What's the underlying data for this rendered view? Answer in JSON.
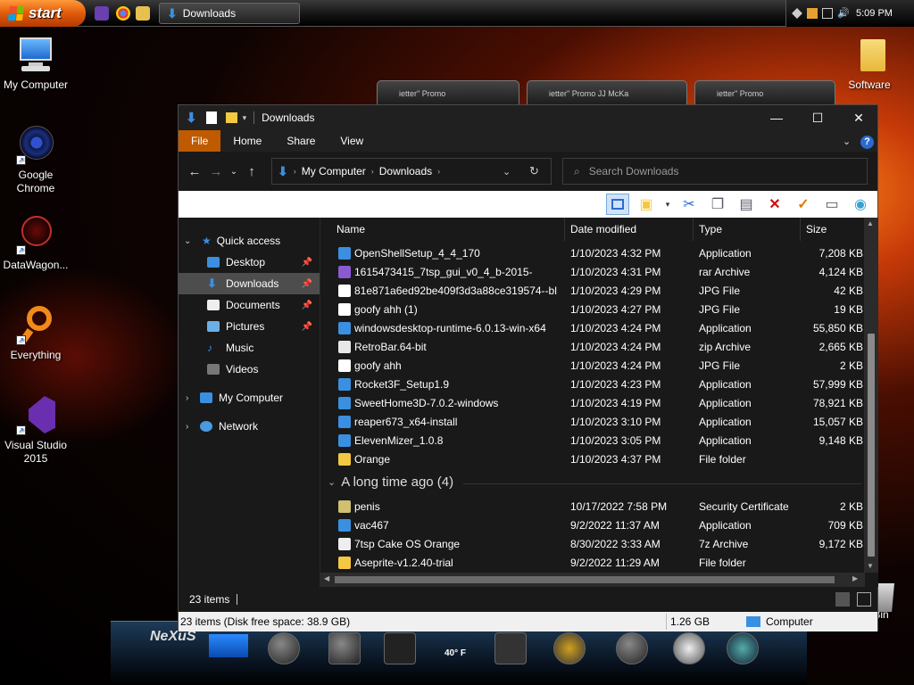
{
  "taskbar": {
    "start_label": "start",
    "task_label": "Downloads",
    "clock": "5:09 PM"
  },
  "desktop_icons": {
    "my_computer": "My Computer",
    "chrome": "Google Chrome",
    "datawagon": "DataWagon...",
    "everything": "Everything",
    "vs": "Visual Studio 2015",
    "software": "Software",
    "recycle": "e Bin"
  },
  "widgets": [
    "ietter\" Promo",
    "ietter\" Promo JJ McKa",
    "ietter\" Promo"
  ],
  "dock": {
    "weather": "40° F"
  },
  "window": {
    "title": "Downloads",
    "ribbon_tabs": [
      "File",
      "Home",
      "Share",
      "View"
    ],
    "address": {
      "seg1": "My Computer",
      "seg2": "Downloads"
    },
    "search_placeholder": "Search Downloads",
    "nav": {
      "quick_access": "Quick access",
      "desktop": "Desktop",
      "downloads": "Downloads",
      "documents": "Documents",
      "pictures": "Pictures",
      "music": "Music",
      "videos": "Videos",
      "my_computer": "My Computer",
      "network": "Network"
    },
    "columns": {
      "name": "Name",
      "date": "Date modified",
      "type": "Type",
      "size": "Size"
    },
    "files": [
      {
        "name": "OpenShellSetup_4_4_170",
        "date": "1/10/2023 4:32 PM",
        "type": "Application",
        "size": "7,208 KB"
      },
      {
        "name": "1615473415_7tsp_gui_v0_4_b-2015-",
        "date": "1/10/2023 4:31 PM",
        "type": "rar Archive",
        "size": "4,124 KB"
      },
      {
        "name": "81e871a6ed92be409f3d3a88ce319574--bl...",
        "date": "1/10/2023 4:29 PM",
        "type": "JPG File",
        "size": "42 KB"
      },
      {
        "name": "goofy ahh (1)",
        "date": "1/10/2023 4:27 PM",
        "type": "JPG File",
        "size": "19 KB"
      },
      {
        "name": "windowsdesktop-runtime-6.0.13-win-x64",
        "date": "1/10/2023 4:24 PM",
        "type": "Application",
        "size": "55,850 KB"
      },
      {
        "name": "RetroBar.64-bit",
        "date": "1/10/2023 4:24 PM",
        "type": "zip Archive",
        "size": "2,665 KB"
      },
      {
        "name": "goofy ahh",
        "date": "1/10/2023 4:24 PM",
        "type": "JPG File",
        "size": "2 KB"
      },
      {
        "name": "Rocket3F_Setup1.9",
        "date": "1/10/2023 4:23 PM",
        "type": "Application",
        "size": "57,999 KB"
      },
      {
        "name": "SweetHome3D-7.0.2-windows",
        "date": "1/10/2023 4:19 PM",
        "type": "Application",
        "size": "78,921 KB"
      },
      {
        "name": "reaper673_x64-install",
        "date": "1/10/2023 3:10 PM",
        "type": "Application",
        "size": "15,057 KB"
      },
      {
        "name": "ElevenMizer_1.0.8",
        "date": "1/10/2023 3:05 PM",
        "type": "Application",
        "size": "9,148 KB"
      },
      {
        "name": "Orange",
        "date": "1/10/2023 4:37 PM",
        "type": "File folder",
        "size": ""
      }
    ],
    "group_label": "A long time ago (4)",
    "old_files": [
      {
        "name": "penis",
        "date": "10/17/2022 7:58 PM",
        "type": "Security Certificate",
        "size": "2 KB"
      },
      {
        "name": "vac467",
        "date": "9/2/2022 11:37 AM",
        "type": "Application",
        "size": "709 KB"
      },
      {
        "name": "7tsp Cake OS Orange",
        "date": "8/30/2022 3:33 AM",
        "type": "7z Archive",
        "size": "9,172 KB"
      },
      {
        "name": "Aseprite-v1.2.40-trial",
        "date": "9/2/2022 11:29 AM",
        "type": "File folder",
        "size": ""
      }
    ],
    "status_items": "23 items",
    "footer": {
      "info": "23 items (Disk free space: 38.9 GB)",
      "size": "1.26 GB",
      "location": "Computer"
    }
  },
  "colors": {
    "accent": "#c05a00",
    "folder": "#f5c842",
    "app_blue": "#3b8fe0"
  }
}
